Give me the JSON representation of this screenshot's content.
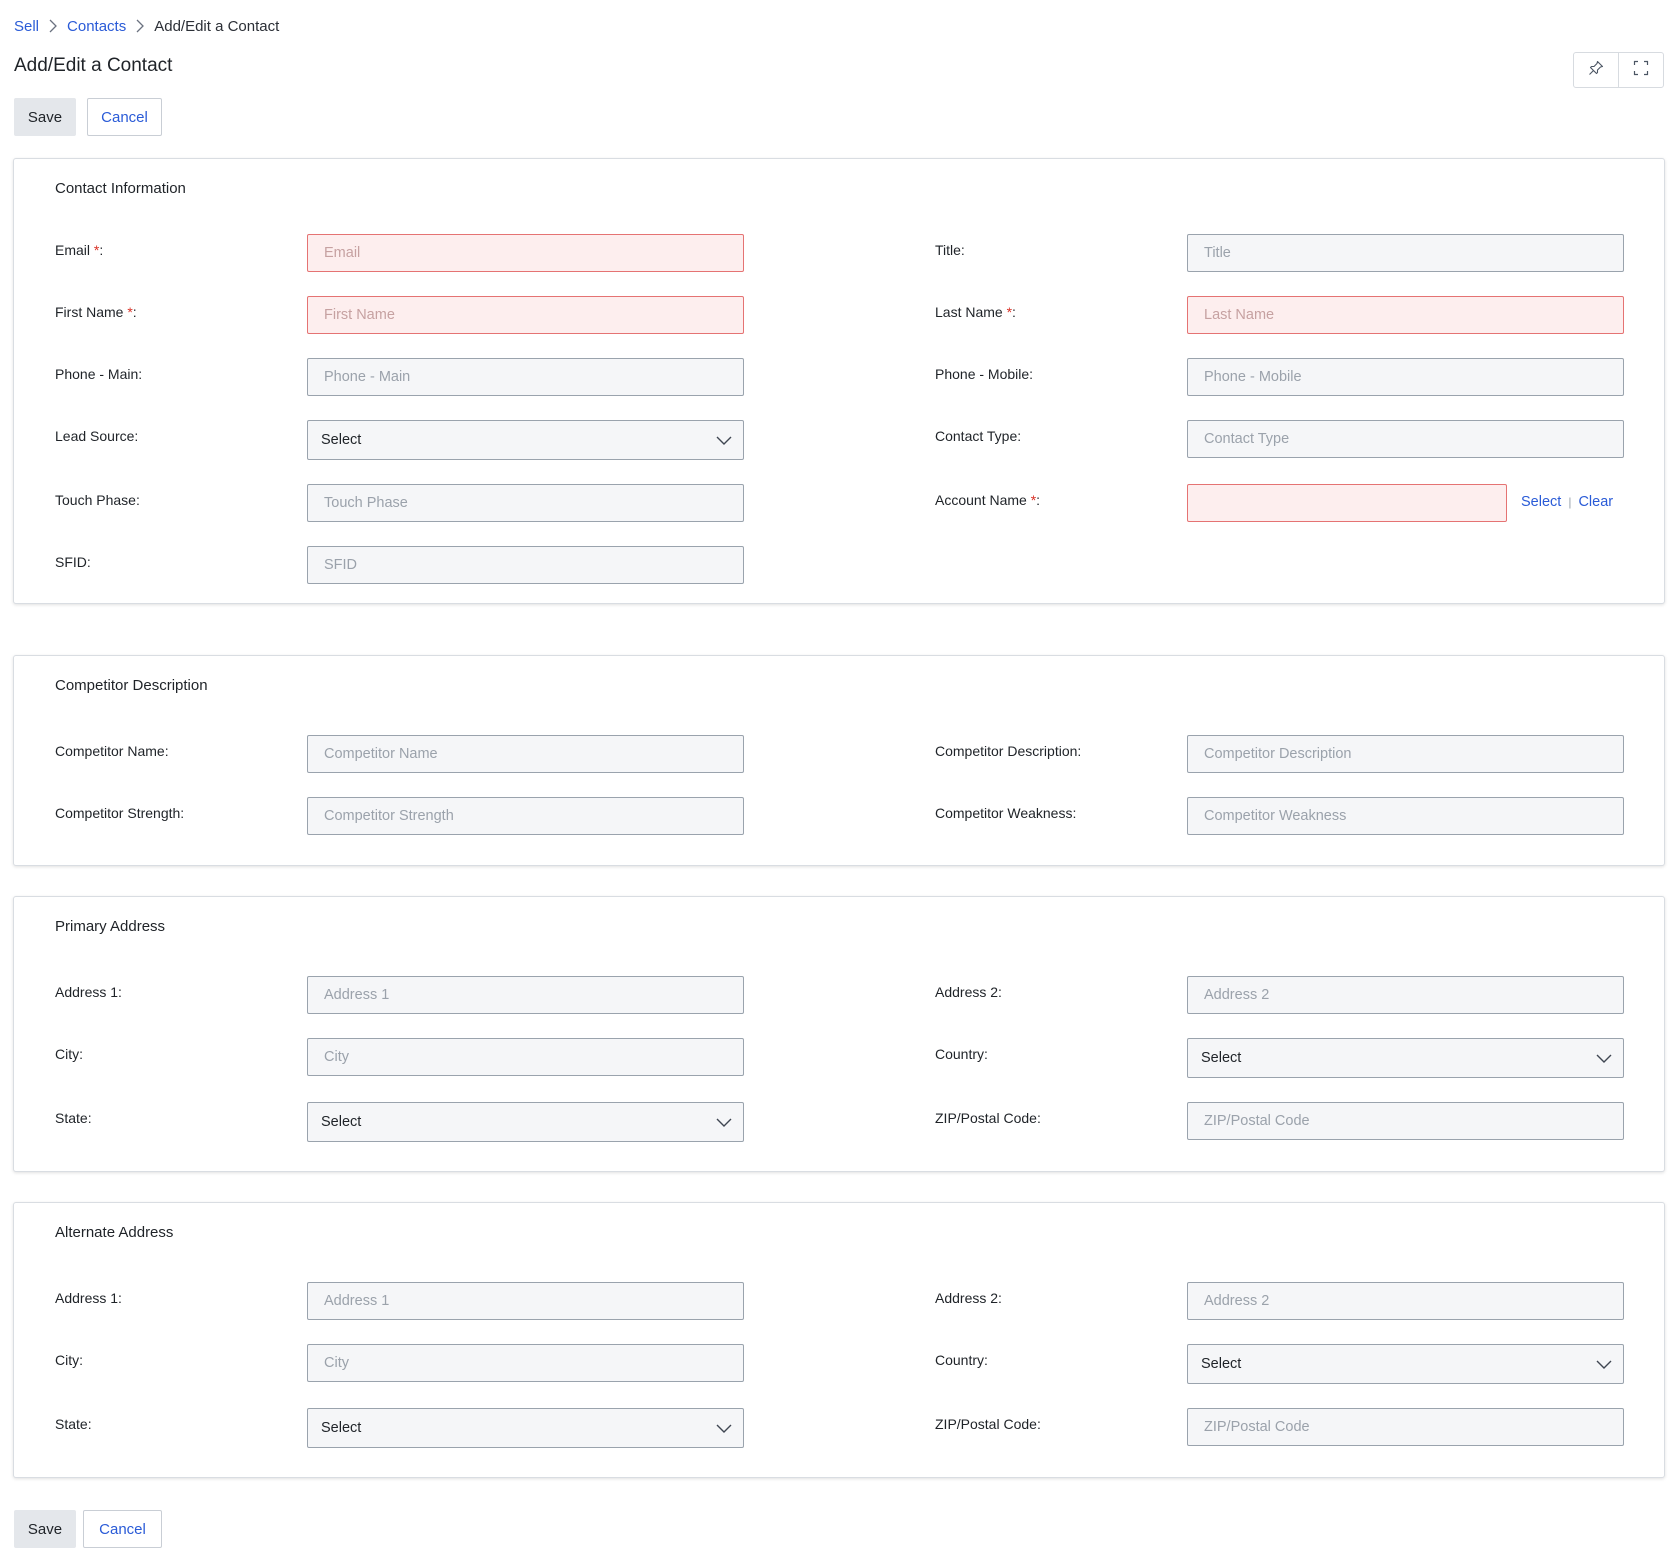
{
  "breadcrumb": {
    "items": [
      "Sell",
      "Contacts"
    ],
    "current": "Add/Edit a Contact"
  },
  "page": {
    "title": "Add/Edit a Contact"
  },
  "actions": {
    "save": "Save",
    "cancel": "Cancel"
  },
  "icons": {
    "pin": "pin-icon",
    "fullscreen": "fullscreen-icon",
    "chevron": "chevron-down-icon",
    "breadcrumb_sep": "chevron-right-icon"
  },
  "colors": {
    "link": "#2a5bd7",
    "required": "#d93025",
    "error_bg": "#fdeeee",
    "error_border": "#e57373"
  },
  "contact_info": {
    "title": "Contact Information",
    "email": {
      "label": "Email",
      "placeholder": "Email"
    },
    "title_field": {
      "label": "Title:",
      "placeholder": "Title"
    },
    "first_name": {
      "label": "First Name",
      "placeholder": "First Name"
    },
    "last_name": {
      "label": "Last Name",
      "placeholder": "Last Name"
    },
    "phone_main": {
      "label": "Phone - Main:",
      "placeholder": "Phone - Main"
    },
    "phone_mobile": {
      "label": "Phone - Mobile:",
      "placeholder": "Phone - Mobile"
    },
    "lead_source": {
      "label": "Lead Source:",
      "value": "Select"
    },
    "contact_type": {
      "label": "Contact Type:",
      "placeholder": "Contact Type"
    },
    "touch_phase": {
      "label": "Touch Phase:",
      "placeholder": "Touch Phase"
    },
    "account_name": {
      "label": "Account Name",
      "select": "Select",
      "clear": "Clear"
    },
    "sfid": {
      "label": "SFID:",
      "placeholder": "SFID"
    }
  },
  "competitor": {
    "title": "Competitor Description",
    "name": {
      "label": "Competitor Name:",
      "placeholder": "Competitor Name"
    },
    "description": {
      "label": "Competitor Description:",
      "placeholder": "Competitor Description"
    },
    "strength": {
      "label": "Competitor Strength:",
      "placeholder": "Competitor Strength"
    },
    "weakness": {
      "label": "Competitor Weakness:",
      "placeholder": "Competitor Weakness"
    }
  },
  "primary_address": {
    "title": "Primary Address",
    "address1": {
      "label": "Address 1:",
      "placeholder": "Address 1"
    },
    "address2": {
      "label": "Address 2:",
      "placeholder": "Address 2"
    },
    "city": {
      "label": "City:",
      "placeholder": "City"
    },
    "country": {
      "label": "Country:",
      "value": "Select"
    },
    "state": {
      "label": "State:",
      "value": "Select"
    },
    "zip": {
      "label": "ZIP/Postal Code:",
      "placeholder": "ZIP/Postal Code"
    }
  },
  "alternate_address": {
    "title": "Alternate Address",
    "address1": {
      "label": "Address 1:",
      "placeholder": "Address 1"
    },
    "address2": {
      "label": "Address 2:",
      "placeholder": "Address 2"
    },
    "city": {
      "label": "City:",
      "placeholder": "City"
    },
    "country": {
      "label": "Country:",
      "value": "Select"
    },
    "state": {
      "label": "State:",
      "value": "Select"
    },
    "zip": {
      "label": "ZIP/Postal Code:",
      "placeholder": "ZIP/Postal Code"
    }
  }
}
